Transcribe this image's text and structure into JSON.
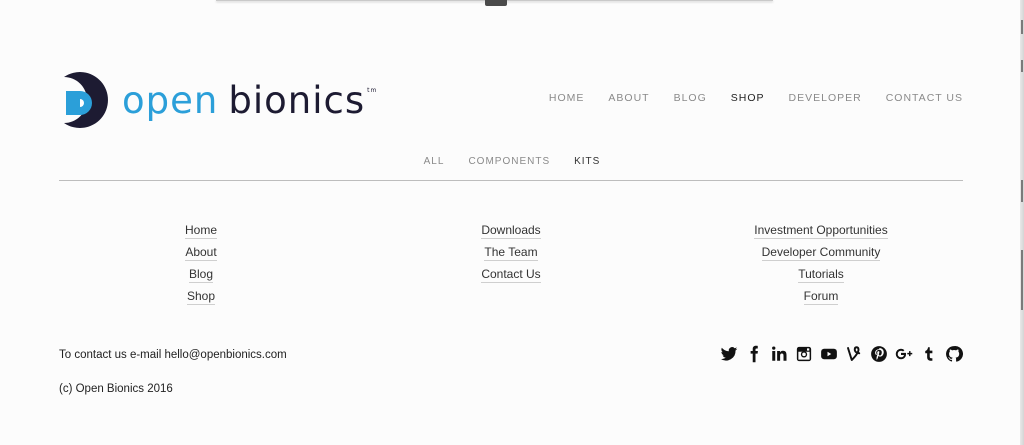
{
  "brand": {
    "name_part1": "open",
    "name_part2": "bionics",
    "tm": "tm",
    "colors": {
      "primary": "#2b9fd9",
      "dark": "#1d1b32"
    }
  },
  "main_nav": [
    {
      "label": "HOME",
      "active": false
    },
    {
      "label": "ABOUT",
      "active": false
    },
    {
      "label": "BLOG",
      "active": false
    },
    {
      "label": "SHOP",
      "active": true
    },
    {
      "label": "DEVELOPER",
      "active": false
    },
    {
      "label": "CONTACT US",
      "active": false
    }
  ],
  "sub_nav": [
    {
      "label": "ALL",
      "active": false
    },
    {
      "label": "COMPONENTS",
      "active": false
    },
    {
      "label": "KITS",
      "active": true
    }
  ],
  "footer_links": {
    "col1": [
      "Home",
      "About",
      "Blog",
      "Shop"
    ],
    "col2": [
      "Downloads",
      "The Team",
      "Contact Us"
    ],
    "col3": [
      "Investment Opportunities",
      "Developer Community",
      "Tutorials",
      "Forum"
    ]
  },
  "contact_text": "To contact us e-mail hello@openbionics.com",
  "copyright": "(c) Open Bionics 2016",
  "social_icons": [
    "twitter-icon",
    "facebook-icon",
    "linkedin-icon",
    "instagram-icon",
    "youtube-icon",
    "vine-icon",
    "pinterest-icon",
    "google-plus-icon",
    "tumblr-icon",
    "github-icon"
  ]
}
